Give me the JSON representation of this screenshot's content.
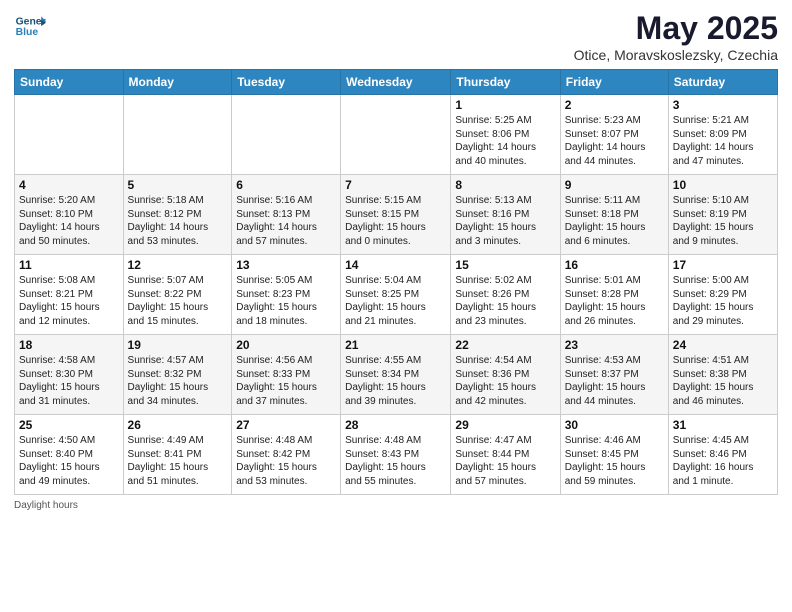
{
  "header": {
    "logo_line1": "General",
    "logo_line2": "Blue",
    "month_title": "May 2025",
    "subtitle": "Otice, Moravskoslezsky, Czechia"
  },
  "days_of_week": [
    "Sunday",
    "Monday",
    "Tuesday",
    "Wednesday",
    "Thursday",
    "Friday",
    "Saturday"
  ],
  "weeks": [
    [
      {
        "num": "",
        "info": ""
      },
      {
        "num": "",
        "info": ""
      },
      {
        "num": "",
        "info": ""
      },
      {
        "num": "",
        "info": ""
      },
      {
        "num": "1",
        "info": "Sunrise: 5:25 AM\nSunset: 8:06 PM\nDaylight: 14 hours\nand 40 minutes."
      },
      {
        "num": "2",
        "info": "Sunrise: 5:23 AM\nSunset: 8:07 PM\nDaylight: 14 hours\nand 44 minutes."
      },
      {
        "num": "3",
        "info": "Sunrise: 5:21 AM\nSunset: 8:09 PM\nDaylight: 14 hours\nand 47 minutes."
      }
    ],
    [
      {
        "num": "4",
        "info": "Sunrise: 5:20 AM\nSunset: 8:10 PM\nDaylight: 14 hours\nand 50 minutes."
      },
      {
        "num": "5",
        "info": "Sunrise: 5:18 AM\nSunset: 8:12 PM\nDaylight: 14 hours\nand 53 minutes."
      },
      {
        "num": "6",
        "info": "Sunrise: 5:16 AM\nSunset: 8:13 PM\nDaylight: 14 hours\nand 57 minutes."
      },
      {
        "num": "7",
        "info": "Sunrise: 5:15 AM\nSunset: 8:15 PM\nDaylight: 15 hours\nand 0 minutes."
      },
      {
        "num": "8",
        "info": "Sunrise: 5:13 AM\nSunset: 8:16 PM\nDaylight: 15 hours\nand 3 minutes."
      },
      {
        "num": "9",
        "info": "Sunrise: 5:11 AM\nSunset: 8:18 PM\nDaylight: 15 hours\nand 6 minutes."
      },
      {
        "num": "10",
        "info": "Sunrise: 5:10 AM\nSunset: 8:19 PM\nDaylight: 15 hours\nand 9 minutes."
      }
    ],
    [
      {
        "num": "11",
        "info": "Sunrise: 5:08 AM\nSunset: 8:21 PM\nDaylight: 15 hours\nand 12 minutes."
      },
      {
        "num": "12",
        "info": "Sunrise: 5:07 AM\nSunset: 8:22 PM\nDaylight: 15 hours\nand 15 minutes."
      },
      {
        "num": "13",
        "info": "Sunrise: 5:05 AM\nSunset: 8:23 PM\nDaylight: 15 hours\nand 18 minutes."
      },
      {
        "num": "14",
        "info": "Sunrise: 5:04 AM\nSunset: 8:25 PM\nDaylight: 15 hours\nand 21 minutes."
      },
      {
        "num": "15",
        "info": "Sunrise: 5:02 AM\nSunset: 8:26 PM\nDaylight: 15 hours\nand 23 minutes."
      },
      {
        "num": "16",
        "info": "Sunrise: 5:01 AM\nSunset: 8:28 PM\nDaylight: 15 hours\nand 26 minutes."
      },
      {
        "num": "17",
        "info": "Sunrise: 5:00 AM\nSunset: 8:29 PM\nDaylight: 15 hours\nand 29 minutes."
      }
    ],
    [
      {
        "num": "18",
        "info": "Sunrise: 4:58 AM\nSunset: 8:30 PM\nDaylight: 15 hours\nand 31 minutes."
      },
      {
        "num": "19",
        "info": "Sunrise: 4:57 AM\nSunset: 8:32 PM\nDaylight: 15 hours\nand 34 minutes."
      },
      {
        "num": "20",
        "info": "Sunrise: 4:56 AM\nSunset: 8:33 PM\nDaylight: 15 hours\nand 37 minutes."
      },
      {
        "num": "21",
        "info": "Sunrise: 4:55 AM\nSunset: 8:34 PM\nDaylight: 15 hours\nand 39 minutes."
      },
      {
        "num": "22",
        "info": "Sunrise: 4:54 AM\nSunset: 8:36 PM\nDaylight: 15 hours\nand 42 minutes."
      },
      {
        "num": "23",
        "info": "Sunrise: 4:53 AM\nSunset: 8:37 PM\nDaylight: 15 hours\nand 44 minutes."
      },
      {
        "num": "24",
        "info": "Sunrise: 4:51 AM\nSunset: 8:38 PM\nDaylight: 15 hours\nand 46 minutes."
      }
    ],
    [
      {
        "num": "25",
        "info": "Sunrise: 4:50 AM\nSunset: 8:40 PM\nDaylight: 15 hours\nand 49 minutes."
      },
      {
        "num": "26",
        "info": "Sunrise: 4:49 AM\nSunset: 8:41 PM\nDaylight: 15 hours\nand 51 minutes."
      },
      {
        "num": "27",
        "info": "Sunrise: 4:48 AM\nSunset: 8:42 PM\nDaylight: 15 hours\nand 53 minutes."
      },
      {
        "num": "28",
        "info": "Sunrise: 4:48 AM\nSunset: 8:43 PM\nDaylight: 15 hours\nand 55 minutes."
      },
      {
        "num": "29",
        "info": "Sunrise: 4:47 AM\nSunset: 8:44 PM\nDaylight: 15 hours\nand 57 minutes."
      },
      {
        "num": "30",
        "info": "Sunrise: 4:46 AM\nSunset: 8:45 PM\nDaylight: 15 hours\nand 59 minutes."
      },
      {
        "num": "31",
        "info": "Sunrise: 4:45 AM\nSunset: 8:46 PM\nDaylight: 16 hours\nand 1 minute."
      }
    ]
  ],
  "footer": "Daylight hours"
}
